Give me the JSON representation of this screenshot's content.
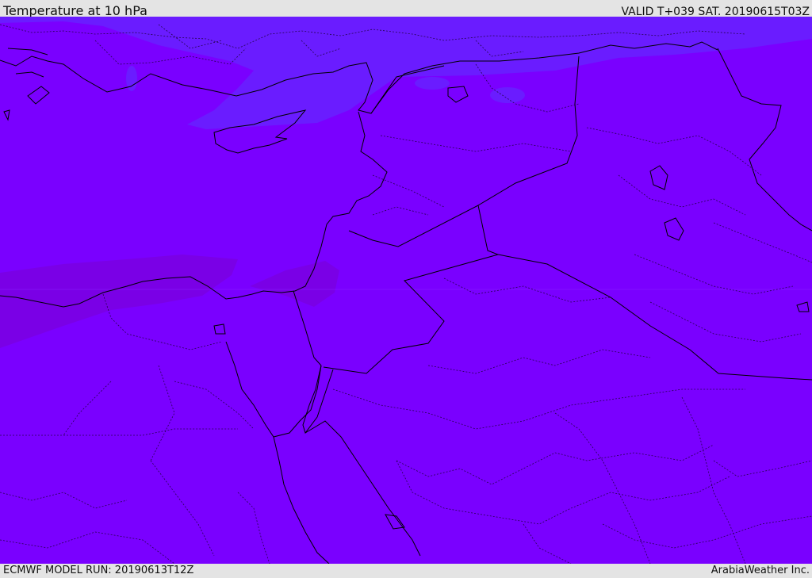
{
  "header": {
    "title": "Temperature at 10 hPa",
    "valid_time": "VALID T+039 SAT. 20190615T03Z"
  },
  "footer": {
    "model_run": "ECMWF MODEL RUN: 20190613T12Z",
    "credit": "ArabiaWeather Inc."
  },
  "map": {
    "field_colors": {
      "base": "#7a00ff",
      "cooler": "#6a1cff",
      "warmer": "#7a00e6"
    },
    "border_color": "#000000"
  }
}
